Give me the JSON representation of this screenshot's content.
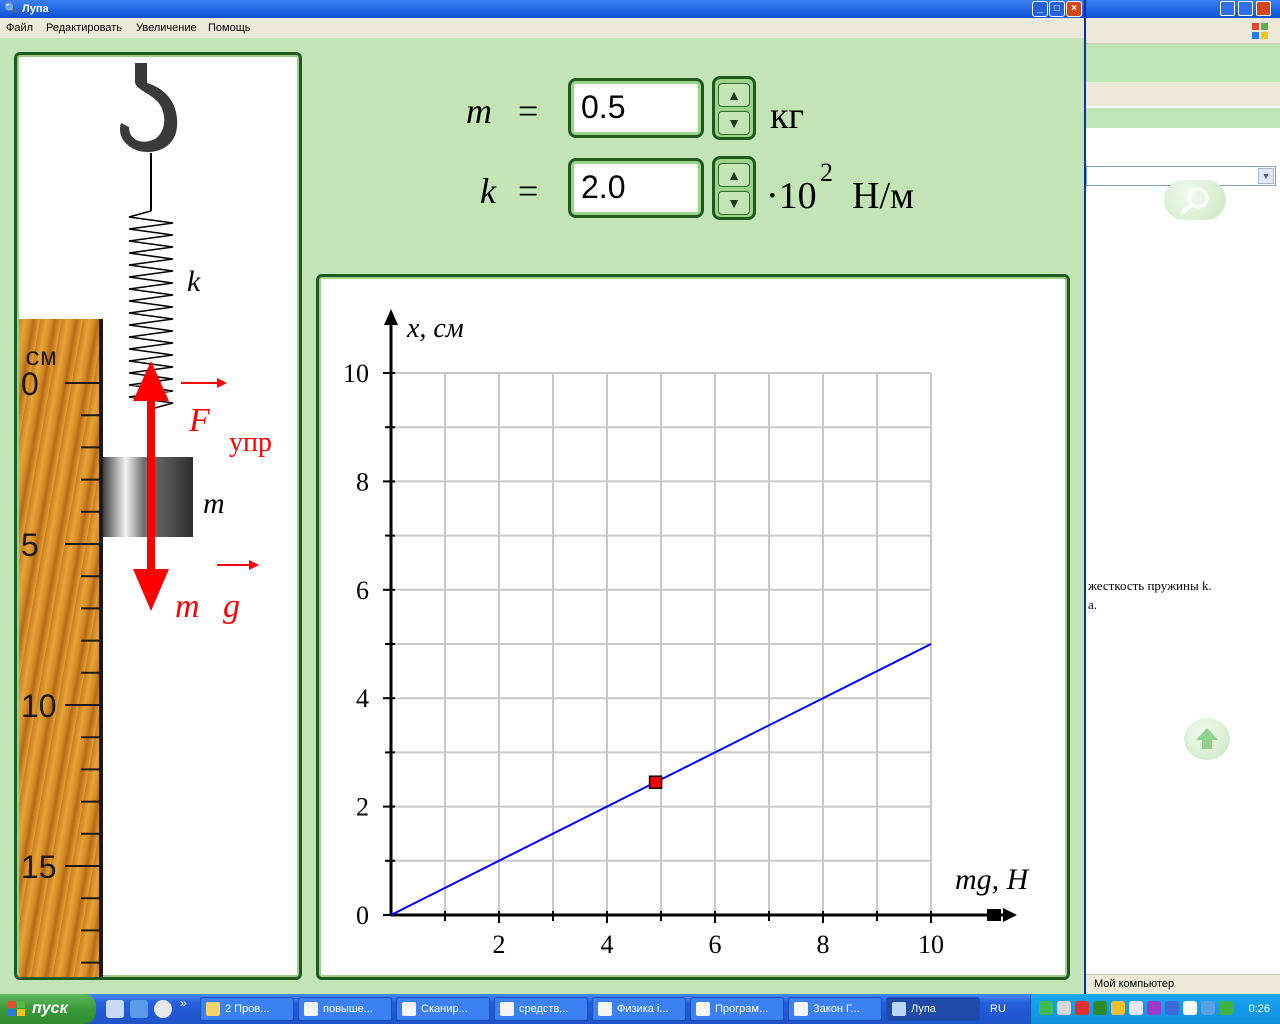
{
  "window": {
    "title": "Лупа"
  },
  "menu": {
    "items": [
      "Файл",
      "Редактировать",
      "Увеличение",
      "Помощь"
    ]
  },
  "parameters": {
    "m": {
      "symbol": "m",
      "equals": "=",
      "value": "0.5",
      "unit": "кг"
    },
    "k": {
      "symbol": "k",
      "equals": "=",
      "value": "2.0",
      "unit_prefix": "·10",
      "unit_exp": "2",
      "unit": "Н/м"
    }
  },
  "diagram": {
    "spring_label": "k",
    "ruler_unit": "см",
    "ruler_ticks": [
      "0",
      "5",
      "10",
      "15"
    ],
    "mass_label": "m",
    "force_up_label": "F",
    "force_up_sub": "упр",
    "force_down_label_m": "m",
    "force_down_label_g": "g",
    "force_color": "#ff0000"
  },
  "chart_data": {
    "type": "line",
    "xlabel": "mg, Н",
    "ylabel": "x, см",
    "xlim": [
      0,
      10
    ],
    "ylim": [
      0,
      10
    ],
    "x_ticks": [
      "2",
      "4",
      "6",
      "8",
      "10"
    ],
    "y_ticks": [
      "0",
      "2",
      "4",
      "6",
      "8",
      "10"
    ],
    "grid": true,
    "series": [
      {
        "x": [
          0,
          10
        ],
        "y": [
          0,
          5
        ],
        "color": "#0000ff"
      }
    ],
    "current_point": {
      "x": 4.9,
      "y": 2.45,
      "color": "#ff0000"
    }
  },
  "background_window": {
    "text_line1": "жесткость пружины k.",
    "text_line2": "а.",
    "status": "Мой компьютер"
  },
  "taskbar": {
    "start_label": "пуск",
    "tasks": [
      "2 Пров...",
      "повыше...",
      "Сканир...",
      "средств...",
      "Физика i...",
      "Програм...",
      "Закон Г...",
      "Лупа"
    ],
    "language": "RU",
    "clock": "0:26"
  }
}
